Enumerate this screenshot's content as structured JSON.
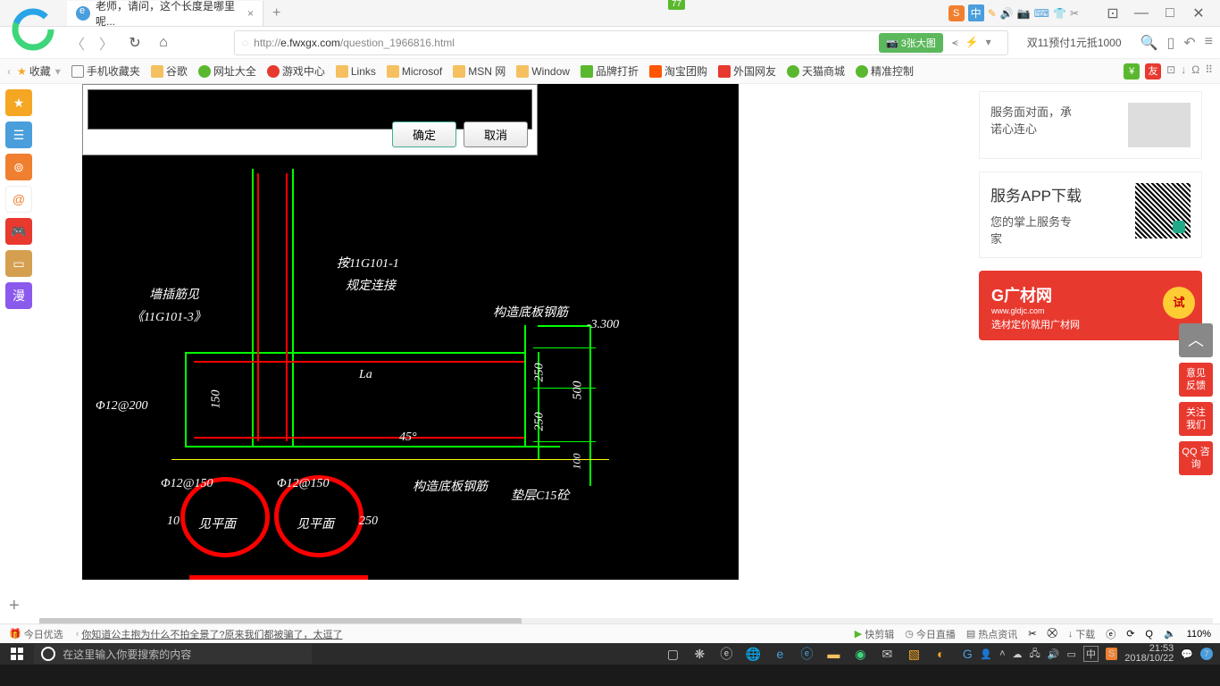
{
  "titlebar": {
    "tab_title": "老师，请问，这个长度是哪里呢...",
    "sogou_badge": "77",
    "sogou_items": [
      "中",
      "✎",
      "🔊",
      "📷",
      "⌨",
      "👕",
      "✂"
    ]
  },
  "addrbar": {
    "url_prefix": "http://",
    "url_host": "e.fwxgx.com",
    "url_path": "/question_1966816.html",
    "img_count": "3张大图",
    "promo": "双11预付1元抵1000"
  },
  "bookmarks": {
    "fav": "收藏",
    "items": [
      "手机收藏夹",
      "谷歌",
      "网址大全",
      "游戏中心",
      "Links",
      "Microsof",
      "MSN 网",
      "Window",
      "品牌打折",
      "淘宝团购",
      "外国网友",
      "天猫商城",
      "精准控制"
    ]
  },
  "dock": [
    "★",
    "☰",
    "⊚",
    "@",
    "🎮",
    "▭",
    "漫"
  ],
  "dialog": {
    "ok": "确定",
    "cancel": "取消"
  },
  "cad": {
    "t1": "墙插筋见",
    "t2": "《11G101-3》",
    "t3": "按11G101-1",
    "t4": "规定连接",
    "t5": "构造底板钢筋",
    "t6": "-3.300",
    "t7": "Φ12@200",
    "t8": "150",
    "t9": "La",
    "t10": "250",
    "t11": "500",
    "t12": "250",
    "t13": "100",
    "t14": "45°",
    "t15": "Φ12@150",
    "t16": "Φ12@150",
    "t17": "构造底板钢筋",
    "t18": "垫层C15砼",
    "t19": "10",
    "t20": "见平面",
    "t21": "见平面",
    "t22": "250"
  },
  "sidebar": {
    "svc1a": "服务面对面，承",
    "svc1b": "诺心连心",
    "svc2_title": "服务APP下载",
    "svc2a": "您的掌上服务专",
    "svc2b": "家",
    "ad_logo": "G广材网",
    "ad_domain": "www.gldjc.com",
    "ad_sub": "选材定价就用广材网",
    "try": "试"
  },
  "float": [
    "意见\n反馈",
    "关注\n我们",
    "QQ\n咨询"
  ],
  "statusbar": {
    "today": "今日优选",
    "headline": "你知道公主抱为什么不拍全景了?原来我们都被骗了，太逗了",
    "items": [
      "快剪辑",
      "今日直播",
      "热点资讯",
      "下载",
      "ⓔ",
      "⟳",
      "Q",
      "🔈"
    ],
    "zoom": "110%"
  },
  "cortana": {
    "placeholder": "在这里输入你要搜索的内容"
  },
  "tray": {
    "time": "21:53",
    "date": "2018/10/22",
    "ime": "中"
  }
}
